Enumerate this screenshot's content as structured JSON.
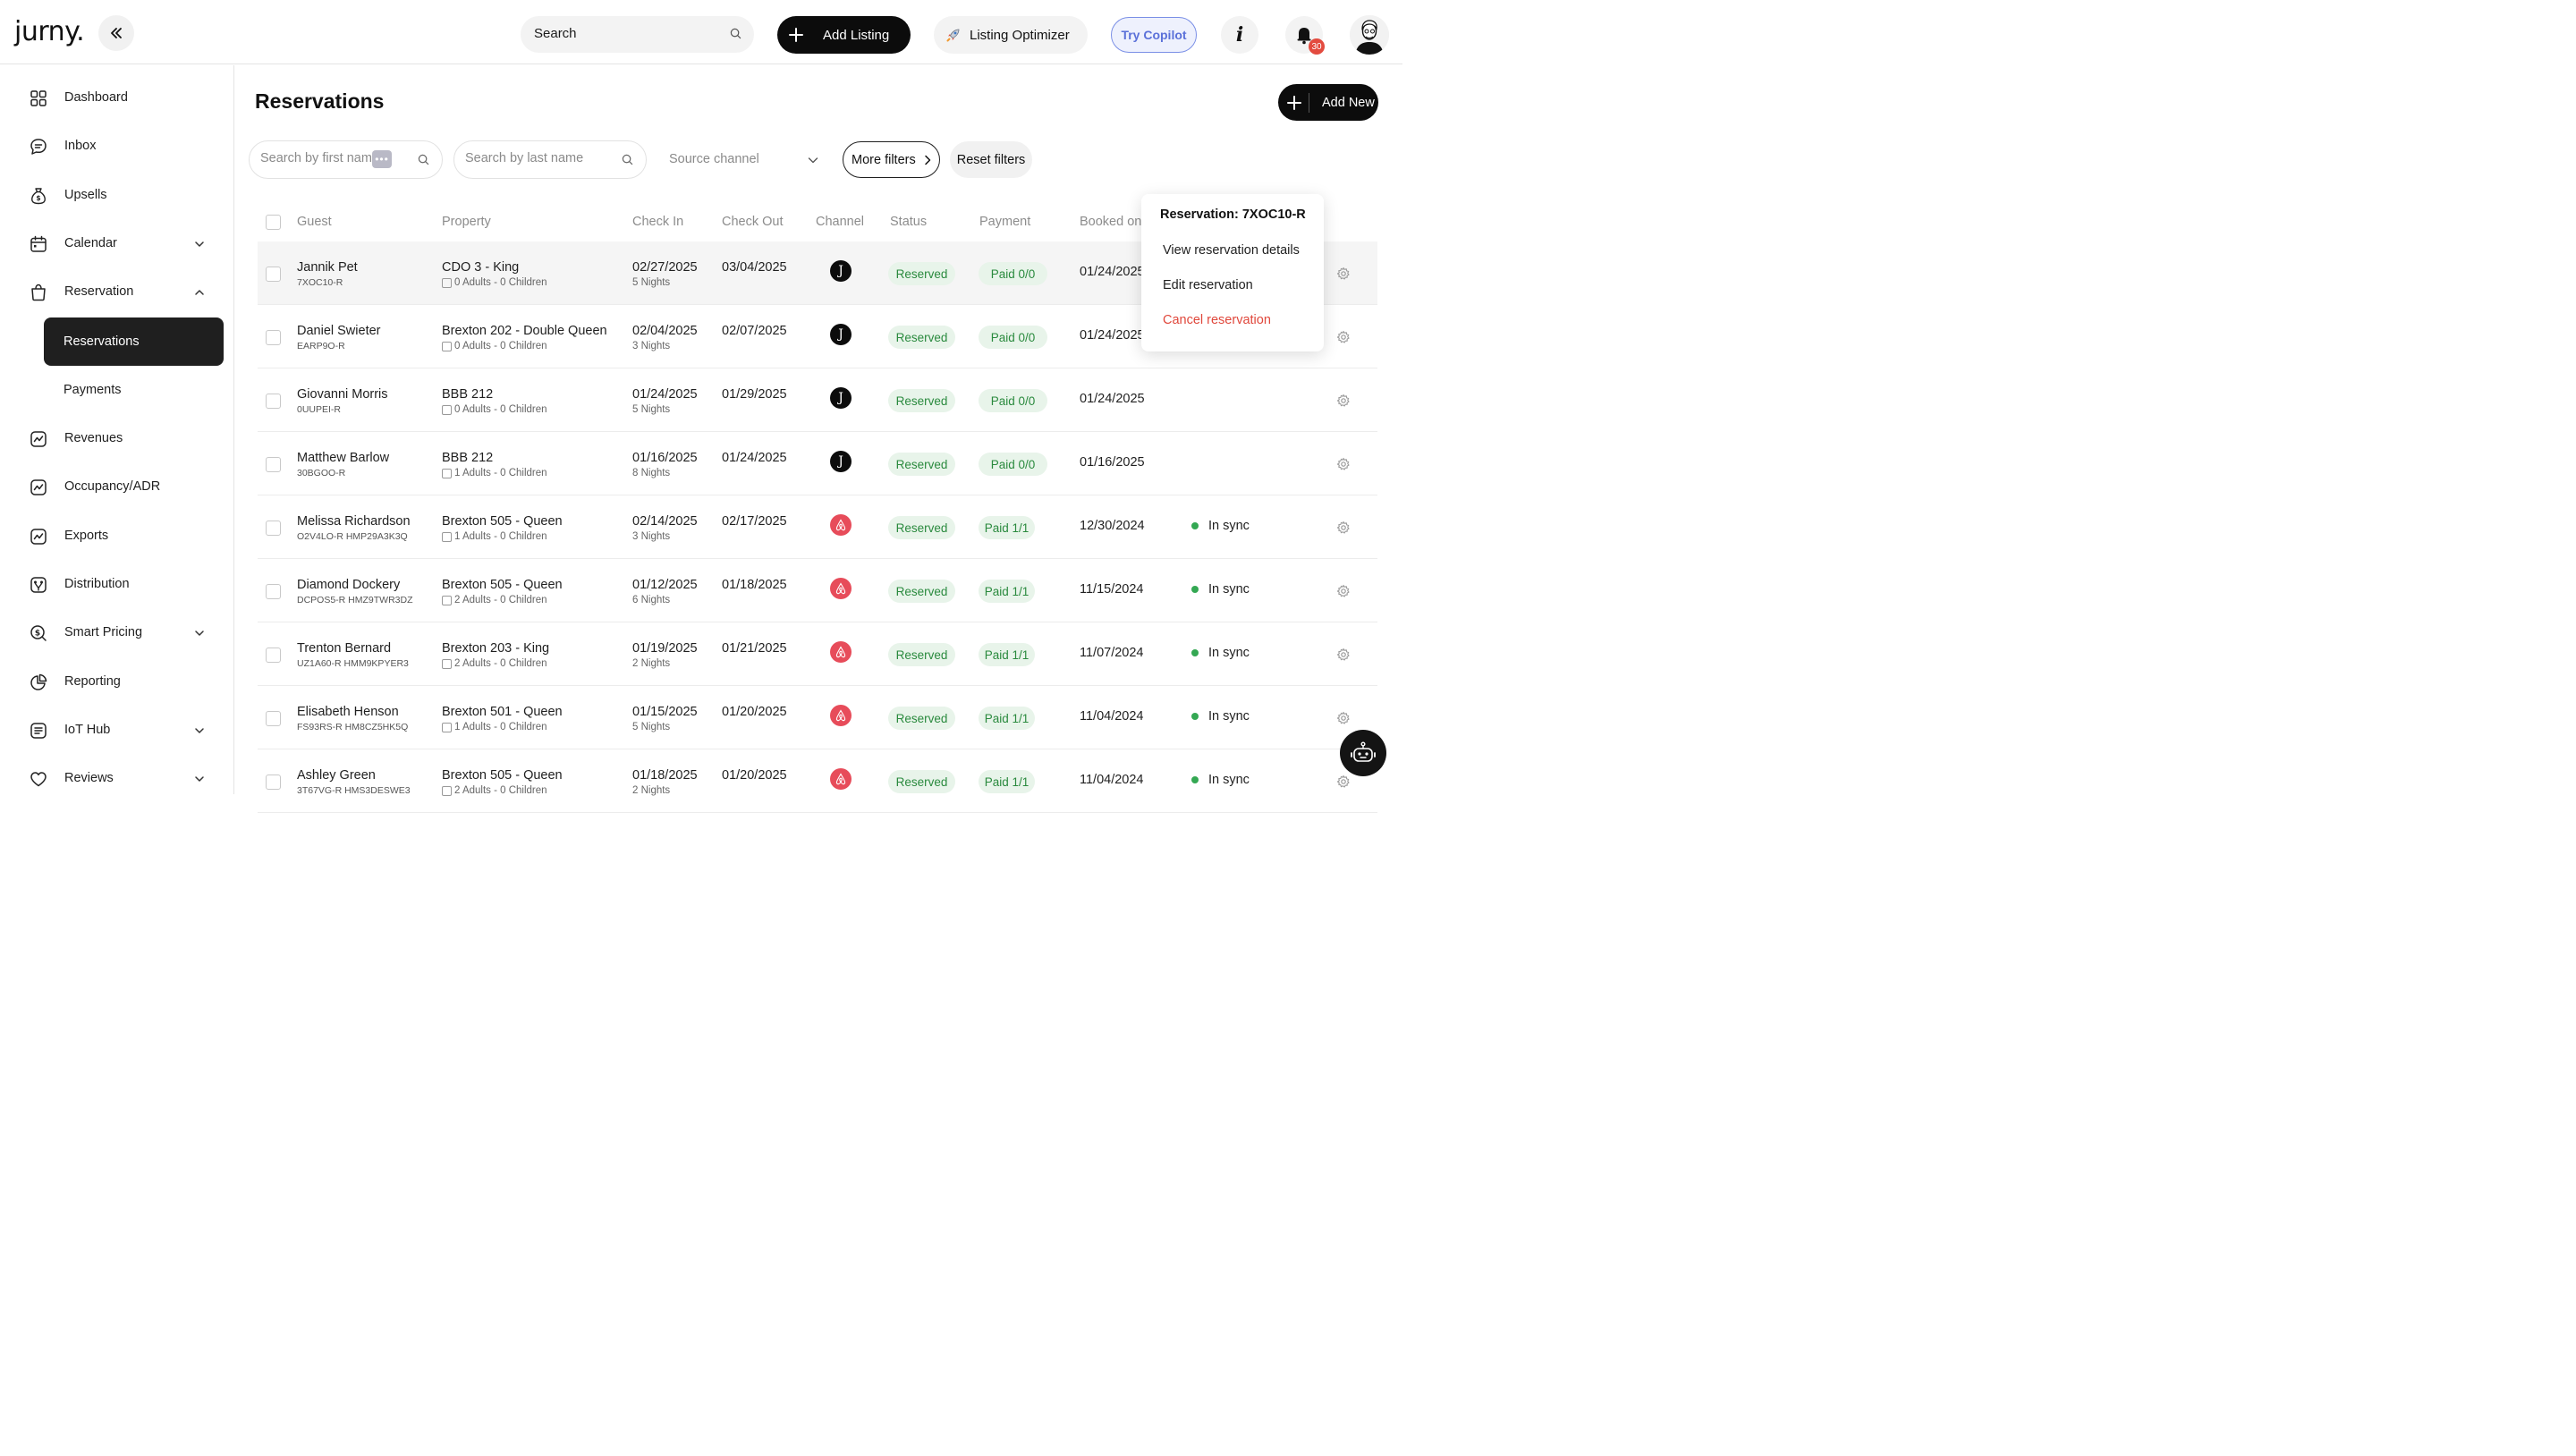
{
  "header": {
    "logo": "jurny.",
    "search_label": "Search",
    "add_listing_label": "Add Listing",
    "optimizer_label": "Listing Optimizer",
    "copilot_label": "Try Copilot",
    "info_label": "i",
    "notification_count": "30"
  },
  "sidebar": {
    "items": [
      {
        "label": "Dashboard"
      },
      {
        "label": "Inbox"
      },
      {
        "label": "Upsells"
      },
      {
        "label": "Calendar"
      },
      {
        "label": "Reservation"
      },
      {
        "label": "Revenues"
      },
      {
        "label": "Occupancy/ADR"
      },
      {
        "label": "Exports"
      },
      {
        "label": "Distribution"
      },
      {
        "label": "Smart Pricing"
      },
      {
        "label": "Reporting"
      },
      {
        "label": "IoT Hub"
      },
      {
        "label": "Reviews"
      }
    ],
    "sub_items": [
      {
        "label": "Reservations",
        "active": true
      },
      {
        "label": "Payments",
        "active": false
      }
    ]
  },
  "page": {
    "title": "Reservations",
    "add_new_label": "Add New"
  },
  "filters": {
    "first_name_placeholder": "Search by first name",
    "last_name_placeholder": "Search by last name",
    "source_channel_placeholder": "Source channel",
    "more_filters_label": "More filters",
    "reset_filters_label": "Reset filters"
  },
  "table": {
    "headers": {
      "guest": "Guest",
      "property": "Property",
      "check_in": "Check In",
      "check_out": "Check Out",
      "channel": "Channel",
      "status": "Status",
      "payment": "Payment",
      "booked_on": "Booked on"
    },
    "rows": [
      {
        "guest": "Jannik Pet",
        "code": "7XOC10-R",
        "property": "CDO 3 - King",
        "occupancy": "0 Adults - 0 Children",
        "check_in": "02/27/2025",
        "nights": "5 Nights",
        "check_out": "03/04/2025",
        "channel": "jurny",
        "channel_letter": "J",
        "status": "Reserved",
        "payment": "Paid 0/0",
        "booked_on": "01/24/2025",
        "sync": ""
      },
      {
        "guest": "Daniel Swieter",
        "code": "EARP9O-R",
        "property": "Brexton 202 - Double Queen",
        "occupancy": "0 Adults - 0 Children",
        "check_in": "02/04/2025",
        "nights": "3 Nights",
        "check_out": "02/07/2025",
        "channel": "jurny",
        "channel_letter": "J",
        "status": "Reserved",
        "payment": "Paid 0/0",
        "booked_on": "01/24/2025",
        "sync": ""
      },
      {
        "guest": "Giovanni Morris",
        "code": "0UUPEI-R",
        "property": "BBB 212",
        "occupancy": "0 Adults - 0 Children",
        "check_in": "01/24/2025",
        "nights": "5 Nights",
        "check_out": "01/29/2025",
        "channel": "jurny",
        "channel_letter": "J",
        "status": "Reserved",
        "payment": "Paid 0/0",
        "booked_on": "01/24/2025",
        "sync": ""
      },
      {
        "guest": "Matthew Barlow",
        "code": "30BGOO-R",
        "property": "BBB 212",
        "occupancy": "1 Adults - 0 Children",
        "check_in": "01/16/2025",
        "nights": "8 Nights",
        "check_out": "01/24/2025",
        "channel": "jurny",
        "channel_letter": "J",
        "status": "Reserved",
        "payment": "Paid 0/0",
        "booked_on": "01/16/2025",
        "sync": ""
      },
      {
        "guest": "Melissa Richardson",
        "code": "O2V4LO-R HMP29A3K3Q",
        "property": "Brexton 505 - Queen",
        "occupancy": "1 Adults - 0 Children",
        "check_in": "02/14/2025",
        "nights": "3 Nights",
        "check_out": "02/17/2025",
        "channel": "airbnb",
        "channel_letter": "",
        "status": "Reserved",
        "payment": "Paid 1/1",
        "booked_on": "12/30/2024",
        "sync": "In sync"
      },
      {
        "guest": "Diamond Dockery",
        "code": "DCPOS5-R HMZ9TWR3DZ",
        "property": "Brexton 505 - Queen",
        "occupancy": "2 Adults - 0 Children",
        "check_in": "01/12/2025",
        "nights": "6 Nights",
        "check_out": "01/18/2025",
        "channel": "airbnb",
        "channel_letter": "",
        "status": "Reserved",
        "payment": "Paid 1/1",
        "booked_on": "11/15/2024",
        "sync": "In sync"
      },
      {
        "guest": "Trenton Bernard",
        "code": "UZ1A60-R HMM9KPYER3",
        "property": "Brexton 203 - King",
        "occupancy": "2 Adults - 0 Children",
        "check_in": "01/19/2025",
        "nights": "2 Nights",
        "check_out": "01/21/2025",
        "channel": "airbnb",
        "channel_letter": "",
        "status": "Reserved",
        "payment": "Paid 1/1",
        "booked_on": "11/07/2024",
        "sync": "In sync"
      },
      {
        "guest": "Elisabeth Henson",
        "code": "FS93RS-R HM8CZ5HK5Q",
        "property": "Brexton 501 - Queen",
        "occupancy": "1 Adults - 0 Children",
        "check_in": "01/15/2025",
        "nights": "5 Nights",
        "check_out": "01/20/2025",
        "channel": "airbnb",
        "channel_letter": "",
        "status": "Reserved",
        "payment": "Paid 1/1",
        "booked_on": "11/04/2024",
        "sync": "In sync"
      },
      {
        "guest": "Ashley Green",
        "code": "3T67VG-R HMS3DESWE3",
        "property": "Brexton 505 - Queen",
        "occupancy": "2 Adults - 0 Children",
        "check_in": "01/18/2025",
        "nights": "2 Nights",
        "check_out": "01/20/2025",
        "channel": "airbnb",
        "channel_letter": "",
        "status": "Reserved",
        "payment": "Paid 1/1",
        "booked_on": "11/04/2024",
        "sync": "In sync"
      }
    ]
  },
  "popup": {
    "title": "Reservation: 7XOC10-R",
    "view_label": "View reservation details",
    "edit_label": "Edit reservation",
    "cancel_label": "Cancel reservation"
  },
  "colors": {
    "primary": "#0c0c0c",
    "success_bg": "#e8f4ea",
    "success_text": "#2a8a3e",
    "danger": "#e0473b",
    "airbnb": "#e74c5a",
    "copilot": "#5b71d9"
  }
}
